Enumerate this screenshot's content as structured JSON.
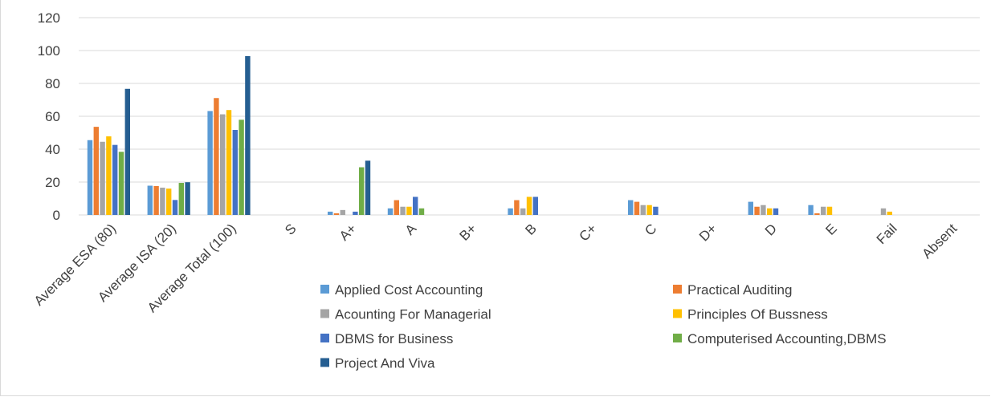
{
  "chart_data": {
    "type": "bar",
    "title": "",
    "xlabel": "",
    "ylabel": "",
    "ylim": [
      0,
      120
    ],
    "yticks": [
      0,
      20,
      40,
      60,
      80,
      100,
      120
    ],
    "grid": true,
    "legend_position": "bottom",
    "categories": [
      "Average ESA (80)",
      "Average ISA (20)",
      "Average Total (100)",
      "S",
      "A+",
      "A",
      "B+",
      "B",
      "C+",
      "C",
      "D+",
      "D",
      "E",
      "Fail",
      "Absent"
    ],
    "series": [
      {
        "name": "Applied Cost Accounting",
        "color": "#5b9bd5",
        "values": [
          45.5,
          17.8,
          63.2,
          0,
          2,
          4,
          0,
          4,
          0,
          9,
          0,
          8,
          6,
          0,
          0
        ]
      },
      {
        "name": "Practical Auditing",
        "color": "#ed7d31",
        "values": [
          53.6,
          17.6,
          71.1,
          0,
          1,
          9,
          0,
          9,
          0,
          8,
          0,
          5,
          1,
          0,
          0
        ]
      },
      {
        "name": "Acounting For Managerial",
        "color": "#a5a5a5",
        "values": [
          44.5,
          16.6,
          61.2,
          0,
          3,
          5,
          0,
          4,
          0,
          6,
          0,
          6,
          5,
          4,
          0
        ]
      },
      {
        "name": "Principles Of Bussness",
        "color": "#ffc000",
        "values": [
          47.8,
          16.0,
          63.8,
          0,
          0,
          5,
          0,
          11,
          0,
          6,
          0,
          4,
          5,
          2,
          0
        ]
      },
      {
        "name": "DBMS for Business",
        "color": "#4472c4",
        "values": [
          42.6,
          9.1,
          51.7,
          0,
          2,
          11,
          0,
          11,
          0,
          5,
          0,
          4,
          0,
          0,
          0
        ]
      },
      {
        "name": "Computerised Accounting,DBMS",
        "color": "#70ad47",
        "values": [
          38.4,
          19.5,
          57.9,
          0,
          29,
          4,
          0,
          0,
          0,
          0,
          0,
          0,
          0,
          0,
          0
        ]
      },
      {
        "name": "Project And Viva",
        "color": "#255e91",
        "values": [
          76.7,
          19.9,
          96.6,
          0,
          33,
          0,
          0,
          0,
          0,
          0,
          0,
          0,
          0,
          0,
          0
        ]
      }
    ]
  }
}
